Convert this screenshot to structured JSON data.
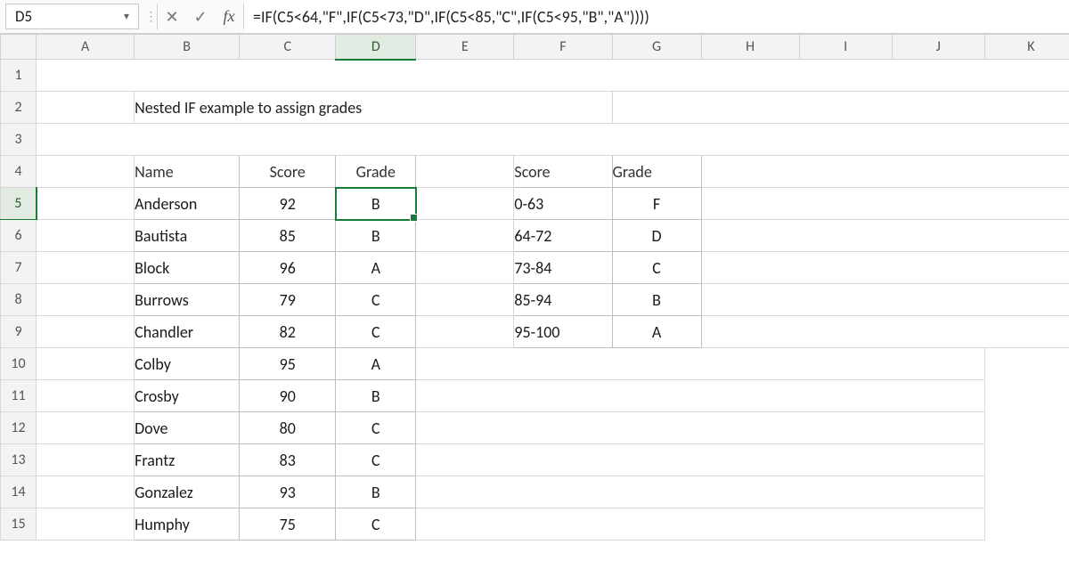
{
  "formula_bar": {
    "cell_ref": "D5",
    "fx_label": "fx",
    "formula": "=IF(C5<64,\"F\",IF(C5<73,\"D\",IF(C5<85,\"C\",IF(C5<95,\"B\",\"A\"))))"
  },
  "columns": [
    "A",
    "B",
    "C",
    "D",
    "E",
    "F",
    "G",
    "H",
    "I",
    "J",
    "K"
  ],
  "row_numbers": [
    "1",
    "2",
    "3",
    "4",
    "5",
    "6",
    "7",
    "8",
    "9",
    "10",
    "11",
    "12",
    "13",
    "14",
    "15"
  ],
  "active": {
    "col": "D",
    "row": "5"
  },
  "title": "Nested IF example to assign grades",
  "grades_table": {
    "headers": {
      "name": "Name",
      "score": "Score",
      "grade": "Grade"
    },
    "rows": [
      {
        "name": "Anderson",
        "score": "92",
        "grade": "B"
      },
      {
        "name": "Bautista",
        "score": "85",
        "grade": "B"
      },
      {
        "name": "Block",
        "score": "96",
        "grade": "A"
      },
      {
        "name": "Burrows",
        "score": "79",
        "grade": "C"
      },
      {
        "name": "Chandler",
        "score": "82",
        "grade": "C"
      },
      {
        "name": "Colby",
        "score": "95",
        "grade": "A"
      },
      {
        "name": "Crosby",
        "score": "90",
        "grade": "B"
      },
      {
        "name": "Dove",
        "score": "80",
        "grade": "C"
      },
      {
        "name": "Frantz",
        "score": "83",
        "grade": "C"
      },
      {
        "name": "Gonzalez",
        "score": "93",
        "grade": "B"
      },
      {
        "name": "Humphy",
        "score": "75",
        "grade": "C"
      }
    ]
  },
  "key_table": {
    "headers": {
      "score": "Score",
      "grade": "Grade"
    },
    "rows": [
      {
        "range": "0-63",
        "grade": "F"
      },
      {
        "range": "64-72",
        "grade": "D"
      },
      {
        "range": "73-84",
        "grade": "C"
      },
      {
        "range": "85-94",
        "grade": "B"
      },
      {
        "range": "95-100",
        "grade": "A"
      }
    ]
  }
}
